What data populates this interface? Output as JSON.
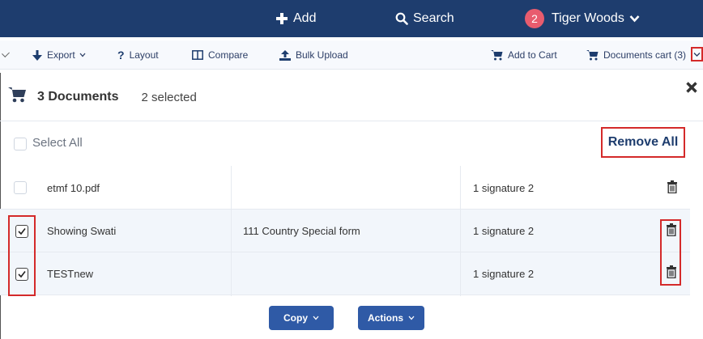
{
  "topbar": {
    "add_label": "Add",
    "search_label": "Search",
    "badge_count": "2",
    "user_name": "Tiger Woods"
  },
  "toolbar": {
    "export_label": "Export",
    "layout_label": "Layout",
    "compare_label": "Compare",
    "bulk_upload_label": "Bulk Upload",
    "add_to_cart_label": "Add to Cart",
    "documents_cart_label": "Documents cart (3)"
  },
  "panel": {
    "documents_count": "3 Documents",
    "selected_text": "2 selected",
    "select_all_label": "Select All",
    "remove_all_label": "Remove All"
  },
  "rows": [
    {
      "name": "etmf 10.pdf",
      "form": "",
      "signature": "1 signature 2",
      "checked": false
    },
    {
      "name": "Showing Swati",
      "form": "111 Country Special form",
      "signature": "1 signature 2",
      "checked": true
    },
    {
      "name": "TESTnew",
      "form": "",
      "signature": "1 signature 2",
      "checked": true
    }
  ],
  "buttons": {
    "copy_label": "Copy",
    "actions_label": "Actions"
  },
  "colors": {
    "nav_bg": "#1e3d6e",
    "accent_blue": "#2f5aa6",
    "highlight_red": "#d42a2a",
    "badge": "#e85c6e"
  }
}
